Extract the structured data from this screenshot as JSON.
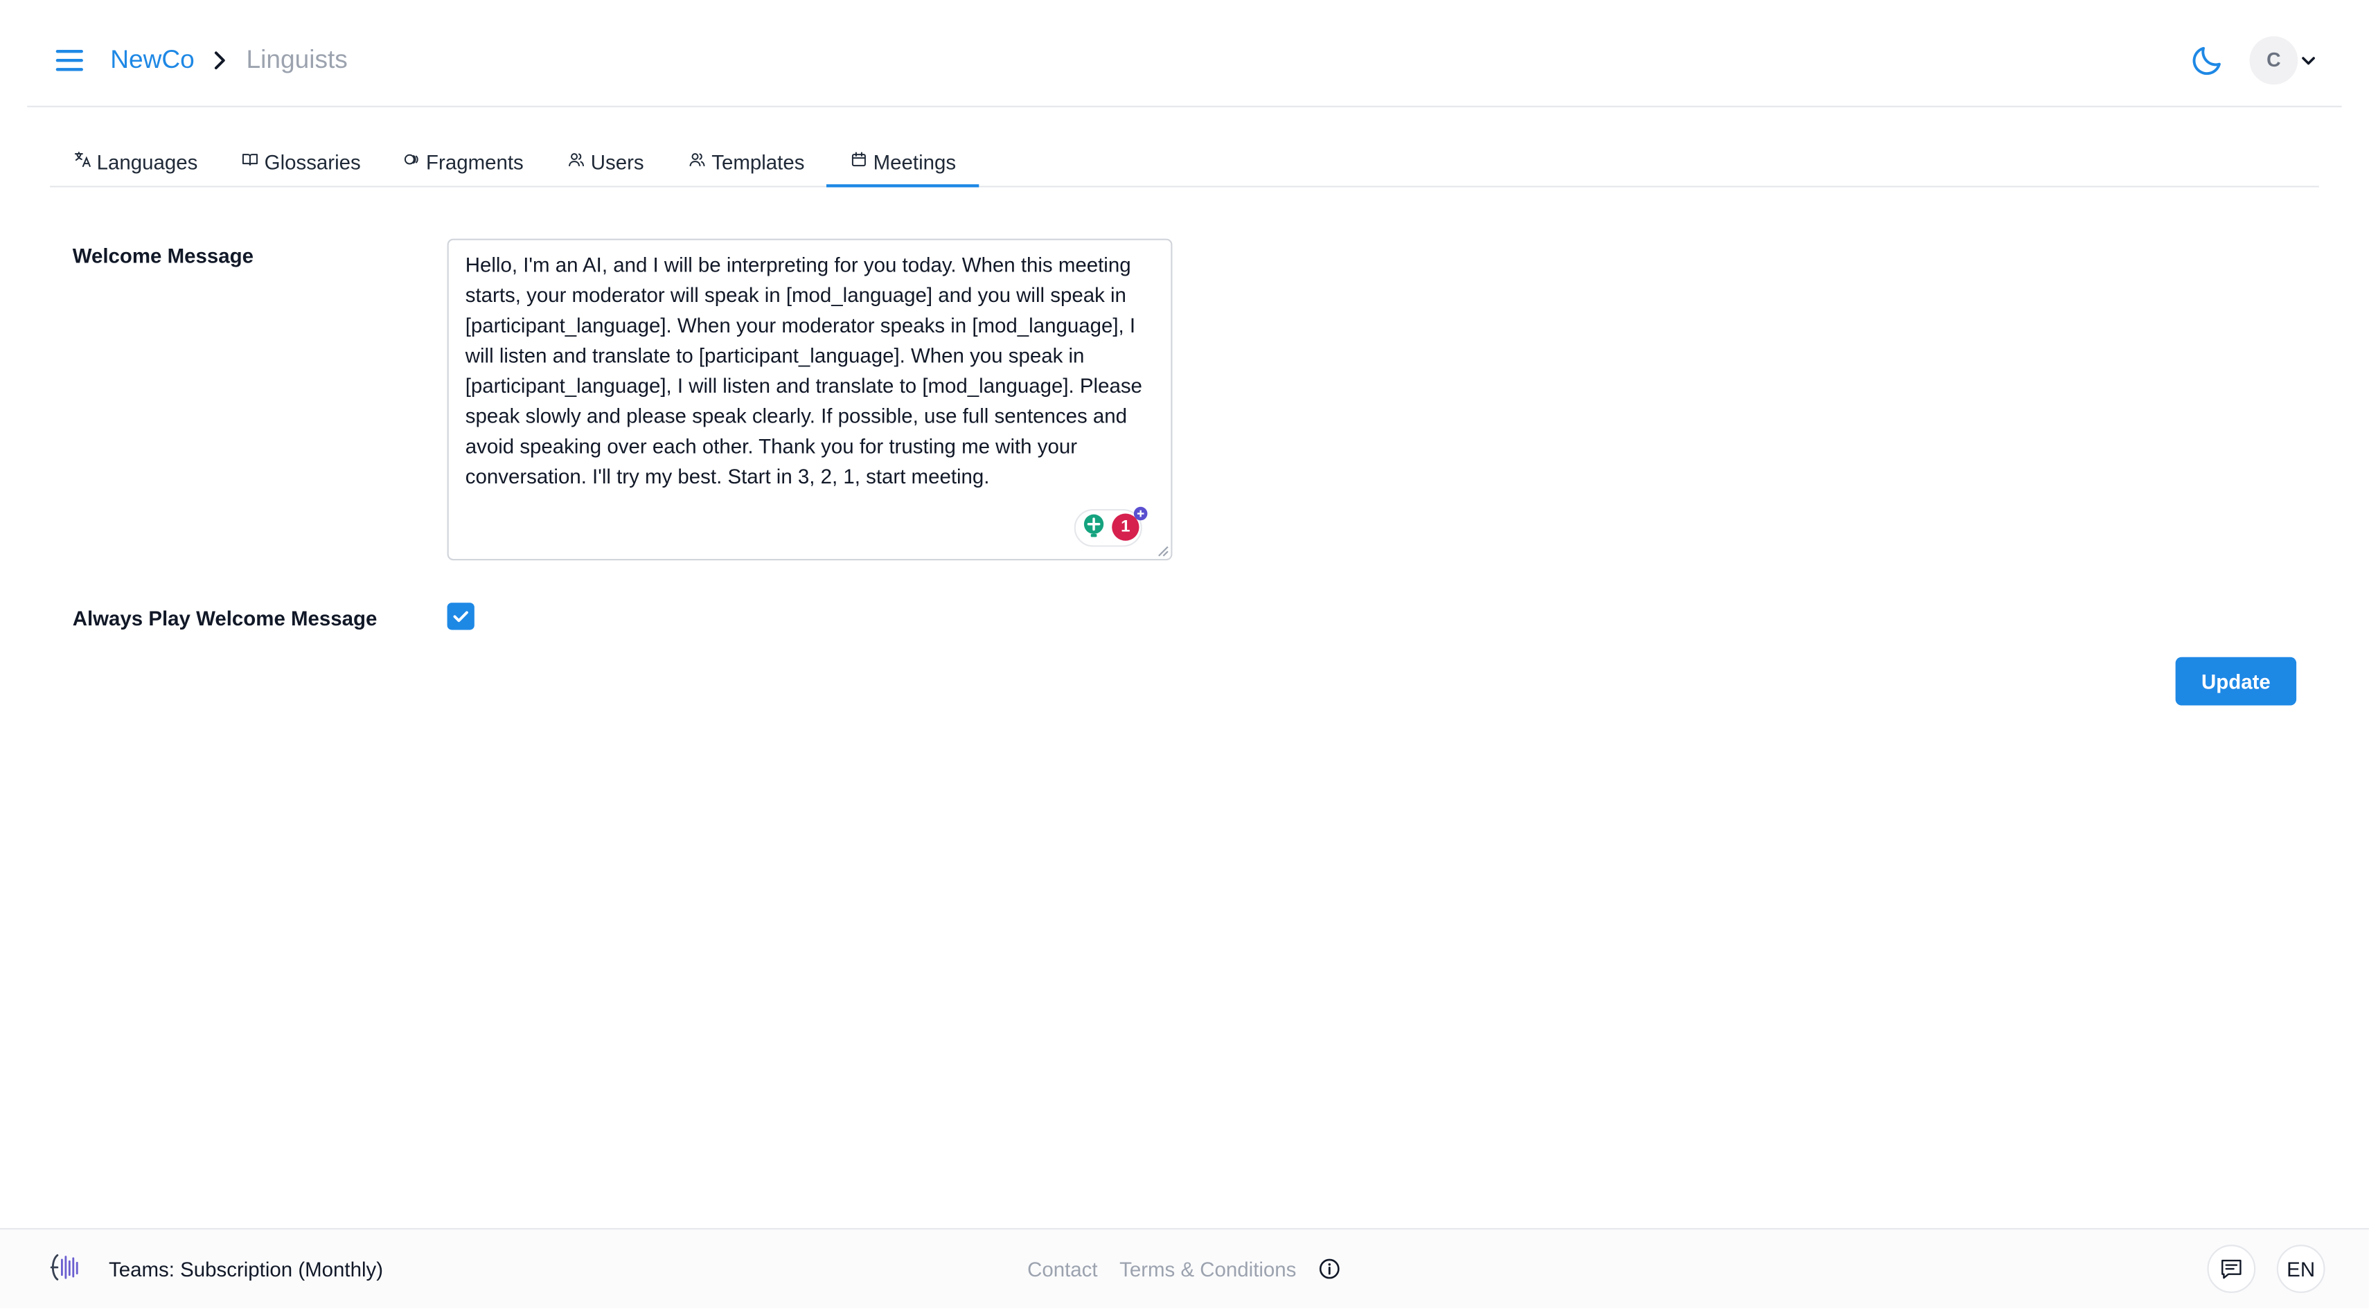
{
  "header": {
    "org": "NewCo",
    "page": "Linguists",
    "avatar_initial": "C"
  },
  "tabs": [
    {
      "label": "Languages",
      "icon": "translate-icon"
    },
    {
      "label": "Glossaries",
      "icon": "book-icon"
    },
    {
      "label": "Fragments",
      "icon": "fragments-icon"
    },
    {
      "label": "Users",
      "icon": "users-icon"
    },
    {
      "label": "Templates",
      "icon": "users-icon"
    },
    {
      "label": "Meetings",
      "icon": "calendar-icon",
      "active": true
    }
  ],
  "form": {
    "welcome_label": "Welcome Message",
    "welcome_value": "Hello, I'm an AI, and I will be interpreting for you today. When this meeting starts, your moderator will speak in [mod_language] and you will speak in [participant_language]. When your moderator speaks in [mod_language], I will listen and translate to [participant_language]. When you speak in [participant_language], I will listen and translate to [mod_language]. Please speak slowly and please speak clearly. If possible, use full sentences and avoid speaking over each other. Thank you for trusting me with your conversation. I'll try my best. Start in 3, 2, 1, start meeting.",
    "grammar_badge_count": "1",
    "always_play_label": "Always Play Welcome Message",
    "always_play_checked": true,
    "update_label": "Update"
  },
  "footer": {
    "plan": "Teams: Subscription (Monthly)",
    "contact": "Contact",
    "terms": "Terms & Conditions",
    "language": "EN"
  },
  "colors": {
    "accent": "#1e88e5",
    "muted": "#9ca3af",
    "grammarly_green": "#15a37f",
    "grammarly_red": "#d6204e"
  }
}
